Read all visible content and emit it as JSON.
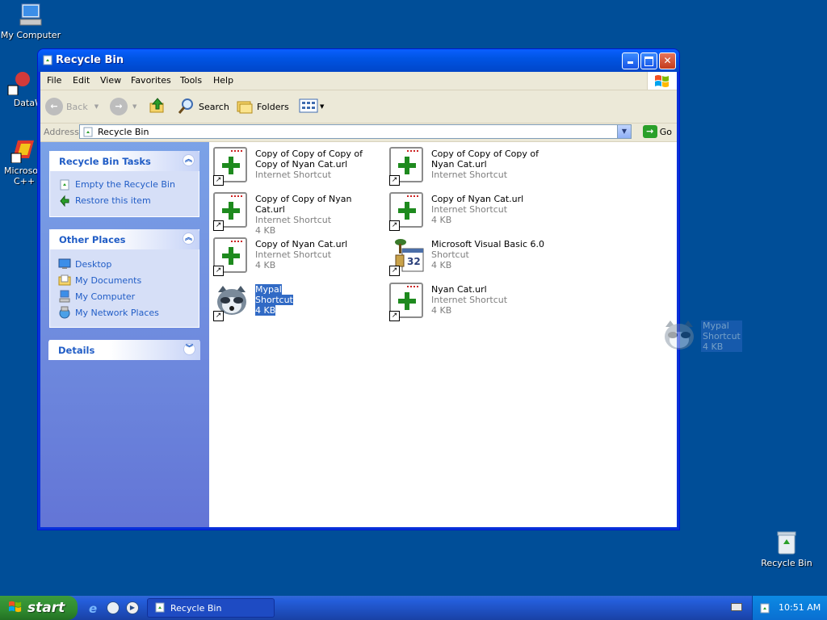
{
  "desktop": {
    "icons": [
      {
        "label": "My Computer"
      },
      {
        "label": "DataWa"
      },
      {
        "label": "Microsoft C++"
      },
      {
        "label": "Recycle Bin"
      }
    ]
  },
  "window": {
    "title": "Recycle Bin",
    "menu": [
      "File",
      "Edit",
      "View",
      "Favorites",
      "Tools",
      "Help"
    ],
    "toolbar": {
      "back": "Back",
      "search": "Search",
      "folders": "Folders"
    },
    "address": {
      "label": "Address",
      "value": "Recycle Bin",
      "go": "Go"
    },
    "tasks": {
      "recycle_title": "Recycle Bin Tasks",
      "recycle_items": [
        "Empty the Recycle Bin",
        "Restore this item"
      ],
      "other_title": "Other Places",
      "other_items": [
        "Desktop",
        "My Documents",
        "My Computer",
        "My Network Places"
      ],
      "details_title": "Details"
    },
    "files": [
      {
        "name": "Copy of Copy of Copy of Copy of Nyan Cat.url",
        "type": "Internet Shortcut",
        "size": ""
      },
      {
        "name": "Copy of Copy of Copy of Nyan Cat.url",
        "type": "Internet Shortcut",
        "size": ""
      },
      {
        "name": "Copy of Copy of Nyan Cat.url",
        "type": "Internet Shortcut",
        "size": "4 KB"
      },
      {
        "name": "Copy of Nyan Cat.url",
        "type": "Internet Shortcut",
        "size": "4 KB"
      },
      {
        "name": "Copy of Nyan Cat.url",
        "type": "Internet Shortcut",
        "size": "4 KB"
      },
      {
        "name": "Microsoft Visual Basic 6.0",
        "type": "Shortcut",
        "size": "4 KB"
      },
      {
        "name": "Mypal",
        "type": "Shortcut",
        "size": "4 KB"
      },
      {
        "name": "Nyan Cat.url",
        "type": "Internet Shortcut",
        "size": "4 KB"
      }
    ],
    "drag_ghost": {
      "name": "Mypal",
      "type": "Shortcut",
      "size": "4 KB"
    }
  },
  "taskbar": {
    "start": "start",
    "active_task": "Recycle Bin",
    "clock": "10:51 AM"
  },
  "colors": {
    "desktop": "#004e98",
    "titlebar": "#0054e3",
    "selection": "#316ac5",
    "link": "#215dc6"
  }
}
